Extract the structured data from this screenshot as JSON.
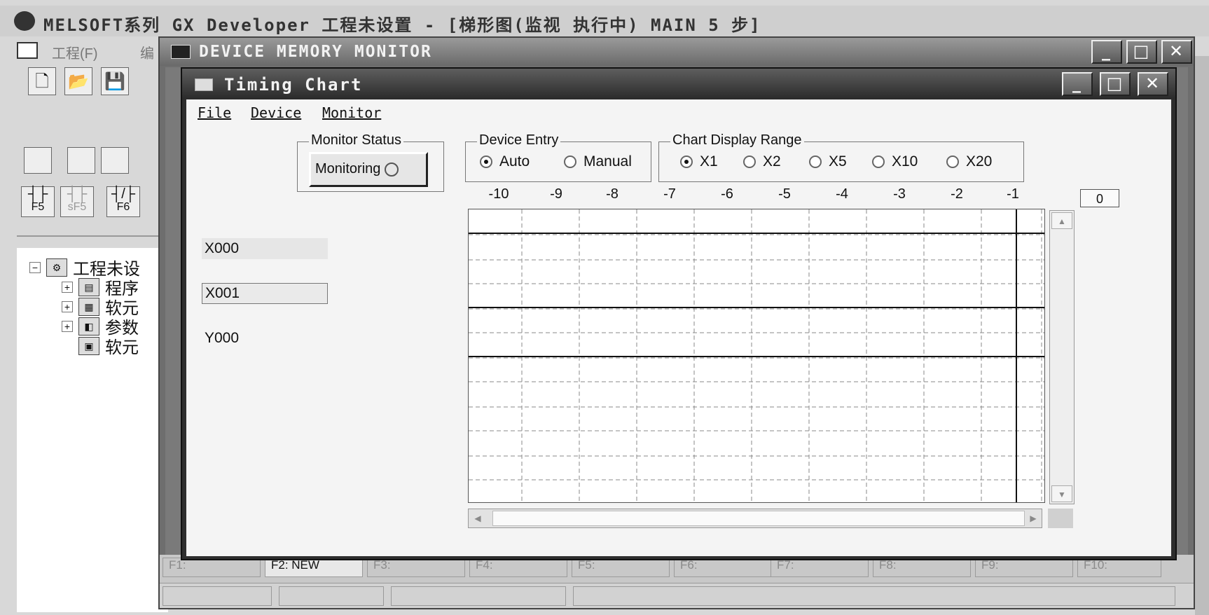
{
  "main_window": {
    "title": "MELSOFT系列 GX Developer 工程未设置 - [梯形图(监视 执行中)        MAIN     5 步]",
    "menu_items": [
      "工程(F)",
      "编"
    ],
    "toolbar_icons": [
      "new-file-icon",
      "open-folder-icon",
      "save-icon"
    ],
    "ladder_buttons": [
      {
        "symbol": "┤├",
        "key": "F5"
      },
      {
        "symbol": "┤├",
        "key": "sF5"
      },
      {
        "symbol": "┤/├",
        "key": "F6"
      }
    ],
    "project_tree": {
      "root": "工程未设",
      "children": [
        "程序",
        "软元",
        "参数",
        "软元"
      ]
    },
    "function_keys": [
      "F1:",
      "F2: NEW",
      "F3:",
      "F4:",
      "F5:",
      "F6:",
      "F7:",
      "F8:",
      "F9:",
      "F10:"
    ]
  },
  "device_memory_monitor": {
    "title": "DEVICE MEMORY MONITOR",
    "icon": "monitor-window-icon"
  },
  "timing_chart": {
    "title": "Timing Chart",
    "menu": [
      "File",
      "Device",
      "Monitor"
    ],
    "monitor_status": {
      "label": "Monitor Status",
      "button_label": "Monitoring"
    },
    "device_entry": {
      "label": "Device Entry",
      "options": [
        "Auto",
        "Manual"
      ],
      "selected": "Auto"
    },
    "chart_display_range": {
      "label": "Chart Display Range",
      "options": [
        "X1",
        "X2",
        "X5",
        "X10",
        "X20"
      ],
      "selected": "X1"
    },
    "devices": [
      "X000",
      "X001",
      "Y000"
    ],
    "time_axis": [
      "-10",
      "-9",
      "-8",
      "-7",
      "-6",
      "-5",
      "-4",
      "-3",
      "-2",
      "-1"
    ],
    "current_time": "0",
    "colors": {
      "title_bar": "#3a3a3a",
      "panel": "#f4f4f4",
      "grid": "#8a8a8a"
    }
  }
}
